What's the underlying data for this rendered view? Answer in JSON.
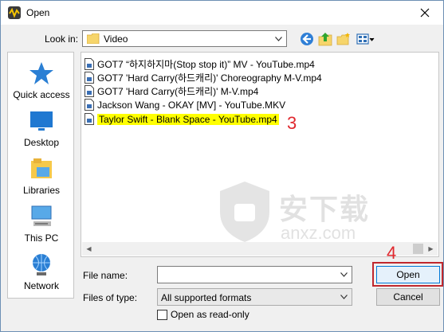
{
  "window": {
    "title": "Open"
  },
  "lookin": {
    "label": "Look in:",
    "value": "Video"
  },
  "places": [
    {
      "label": "Quick access",
      "icon": "star-icon"
    },
    {
      "label": "Desktop",
      "icon": "desktop-icon"
    },
    {
      "label": "Libraries",
      "icon": "libraries-icon"
    },
    {
      "label": "This PC",
      "icon": "computer-icon"
    },
    {
      "label": "Network",
      "icon": "network-icon"
    }
  ],
  "files": [
    {
      "name": "GOT7 “하지하지마(Stop stop it)” MV - YouTube.mp4",
      "selected": false
    },
    {
      "name": "GOT7 'Hard Carry(하드캐리)' Choreography M-V.mp4",
      "selected": false
    },
    {
      "name": "GOT7 'Hard Carry(하드캐리)' M-V.mp4",
      "selected": false
    },
    {
      "name": "Jackson Wang - OKAY [MV] - YouTube.MKV",
      "selected": false
    },
    {
      "name": "Taylor Swift - Blank Space - YouTube.mp4",
      "selected": true
    }
  ],
  "annotations": {
    "step3": "3",
    "step4": "4"
  },
  "watermark": {
    "cn": "安下载",
    "en": "anxz.com"
  },
  "filename": {
    "label": "File name:",
    "value": ""
  },
  "filetype": {
    "label": "Files of type:",
    "value": "All supported formats"
  },
  "readonly": {
    "label": "Open as read-only",
    "checked": false
  },
  "buttons": {
    "open": "Open",
    "cancel": "Cancel"
  },
  "colors": {
    "highlight": "#ffff00",
    "annotation": "#e0282e",
    "accent": "#0078d7"
  }
}
